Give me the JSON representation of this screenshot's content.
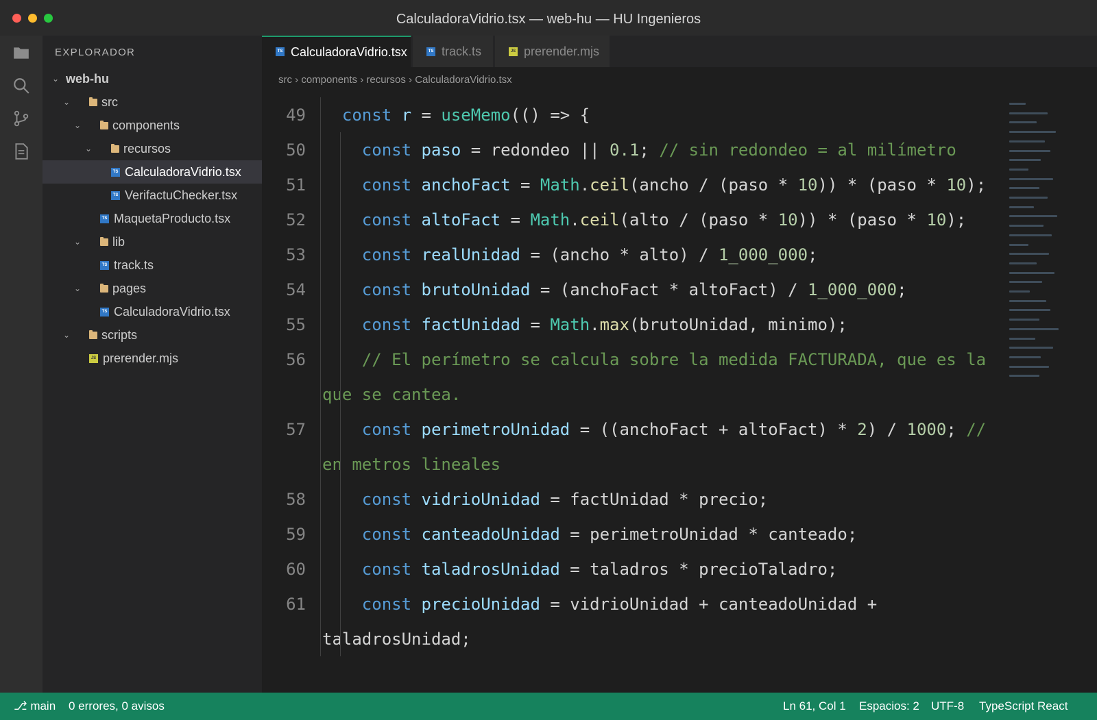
{
  "window": {
    "title": "CalculadoraVidrio.tsx — web-hu — HU Ingenieros"
  },
  "activity_bar": {
    "icons": [
      "files-icon",
      "search-icon",
      "source-control-icon",
      "document-icon"
    ]
  },
  "sidebar": {
    "title": "EXPLORADOR",
    "tree": [
      {
        "label": "web-hu",
        "kind": "root",
        "depth": 0,
        "expanded": true
      },
      {
        "label": "src",
        "kind": "folder",
        "depth": 1,
        "expanded": true
      },
      {
        "label": "components",
        "kind": "folder",
        "depth": 2,
        "expanded": true
      },
      {
        "label": "recursos",
        "kind": "folder",
        "depth": 3,
        "expanded": true
      },
      {
        "label": "CalculadoraVidrio.tsx",
        "kind": "ts",
        "depth": 4,
        "selected": true
      },
      {
        "label": "VerifactuChecker.tsx",
        "kind": "ts",
        "depth": 4
      },
      {
        "label": "MaquetaProducto.tsx",
        "kind": "ts",
        "depth": 3
      },
      {
        "label": "lib",
        "kind": "folder",
        "depth": 2,
        "expanded": true
      },
      {
        "label": "track.ts",
        "kind": "ts",
        "depth": 3
      },
      {
        "label": "pages",
        "kind": "folder",
        "depth": 2,
        "expanded": true
      },
      {
        "label": "CalculadoraVidrio.tsx",
        "kind": "ts",
        "depth": 3
      },
      {
        "label": "scripts",
        "kind": "folder",
        "depth": 1,
        "expanded": true
      },
      {
        "label": "prerender.mjs",
        "kind": "js",
        "depth": 2
      }
    ]
  },
  "tabs": [
    {
      "label": "CalculadoraVidrio.tsx",
      "kind": "ts",
      "active": true
    },
    {
      "label": "track.ts",
      "kind": "ts",
      "active": false
    },
    {
      "label": "prerender.mjs",
      "kind": "js",
      "active": false
    }
  ],
  "breadcrumb": "src › components › recursos › CalculadoraVidrio.tsx",
  "code": {
    "lines": [
      {
        "n": "49",
        "indent": 1,
        "tokens": [
          [
            "kw",
            "const"
          ],
          [
            "t",
            " "
          ],
          [
            "var",
            "r"
          ],
          [
            "t",
            " = "
          ],
          [
            "cls",
            "useMemo"
          ],
          [
            "t",
            "(() => {"
          ]
        ]
      },
      {
        "n": "50",
        "indent": 2,
        "tokens": [
          [
            "kw",
            "const"
          ],
          [
            "t",
            " "
          ],
          [
            "var",
            "paso"
          ],
          [
            "t",
            " = redondeo || "
          ],
          [
            "num",
            "0.1"
          ],
          [
            "t",
            "; "
          ],
          [
            "cm",
            "// sin redondeo = al milímetro"
          ]
        ]
      },
      {
        "n": "51",
        "indent": 2,
        "tokens": [
          [
            "kw",
            "const"
          ],
          [
            "t",
            " "
          ],
          [
            "var",
            "anchoFact"
          ],
          [
            "t",
            " = "
          ],
          [
            "cls",
            "Math"
          ],
          [
            "t",
            "."
          ],
          [
            "fn",
            "ceil"
          ],
          [
            "t",
            "(ancho / (paso * "
          ],
          [
            "num",
            "10"
          ],
          [
            "t",
            ")) * (paso * "
          ],
          [
            "num",
            "10"
          ],
          [
            "t",
            ");"
          ]
        ]
      },
      {
        "n": "52",
        "indent": 2,
        "tokens": [
          [
            "kw",
            "const"
          ],
          [
            "t",
            " "
          ],
          [
            "var",
            "altoFact"
          ],
          [
            "t",
            " = "
          ],
          [
            "cls",
            "Math"
          ],
          [
            "t",
            "."
          ],
          [
            "fn",
            "ceil"
          ],
          [
            "t",
            "(alto / (paso * "
          ],
          [
            "num",
            "10"
          ],
          [
            "t",
            ")) * (paso * "
          ],
          [
            "num",
            "10"
          ],
          [
            "t",
            ");"
          ]
        ]
      },
      {
        "n": "53",
        "indent": 2,
        "tokens": [
          [
            "kw",
            "const"
          ],
          [
            "t",
            " "
          ],
          [
            "var",
            "realUnidad"
          ],
          [
            "t",
            " = (ancho * alto) / "
          ],
          [
            "num",
            "1_000_000"
          ],
          [
            "t",
            ";"
          ]
        ]
      },
      {
        "n": "54",
        "indent": 2,
        "tokens": [
          [
            "kw",
            "const"
          ],
          [
            "t",
            " "
          ],
          [
            "var",
            "brutoUnidad"
          ],
          [
            "t",
            " = (anchoFact * altoFact) / "
          ],
          [
            "num",
            "1_000_000"
          ],
          [
            "t",
            ";"
          ]
        ]
      },
      {
        "n": "55",
        "indent": 2,
        "tokens": [
          [
            "kw",
            "const"
          ],
          [
            "t",
            " "
          ],
          [
            "var",
            "factUnidad"
          ],
          [
            "t",
            " = "
          ],
          [
            "cls",
            "Math"
          ],
          [
            "t",
            "."
          ],
          [
            "fn",
            "max"
          ],
          [
            "t",
            "(brutoUnidad, minimo);"
          ]
        ]
      },
      {
        "n": "56",
        "indent": 2,
        "tokens": [
          [
            "cm",
            "// El perímetro se calcula sobre la medida FACTURADA, que es la"
          ]
        ]
      },
      {
        "n": "",
        "indent": 0,
        "tokens": [
          [
            "cm",
            "que se cantea."
          ]
        ]
      },
      {
        "n": "57",
        "indent": 2,
        "tokens": [
          [
            "kw",
            "const"
          ],
          [
            "t",
            " "
          ],
          [
            "var",
            "perimetroUnidad"
          ],
          [
            "t",
            " = ((anchoFact + altoFact) * "
          ],
          [
            "num",
            "2"
          ],
          [
            "t",
            ") / "
          ],
          [
            "num",
            "1000"
          ],
          [
            "t",
            "; "
          ],
          [
            "cm",
            "//"
          ]
        ]
      },
      {
        "n": "",
        "indent": 0,
        "tokens": [
          [
            "cm",
            "en metros lineales"
          ]
        ]
      },
      {
        "n": "58",
        "indent": 2,
        "tokens": [
          [
            "kw",
            "const"
          ],
          [
            "t",
            " "
          ],
          [
            "var",
            "vidrioUnidad"
          ],
          [
            "t",
            " = factUnidad * precio;"
          ]
        ]
      },
      {
        "n": "59",
        "indent": 2,
        "tokens": [
          [
            "kw",
            "const"
          ],
          [
            "t",
            " "
          ],
          [
            "var",
            "canteadoUnidad"
          ],
          [
            "t",
            " = perimetroUnidad * canteado;"
          ]
        ]
      },
      {
        "n": "60",
        "indent": 2,
        "tokens": [
          [
            "kw",
            "const"
          ],
          [
            "t",
            " "
          ],
          [
            "var",
            "taladrosUnidad"
          ],
          [
            "t",
            " = taladros * precioTaladro;"
          ]
        ]
      },
      {
        "n": "61",
        "indent": 2,
        "tokens": [
          [
            "kw",
            "const"
          ],
          [
            "t",
            " "
          ],
          [
            "var",
            "precioUnidad"
          ],
          [
            "t",
            " = vidrioUnidad + canteadoUnidad +"
          ]
        ]
      },
      {
        "n": "",
        "indent": 0,
        "tokens": [
          [
            "t",
            "taladrosUnidad;"
          ]
        ]
      }
    ]
  },
  "status_bar": {
    "branch": "⎇ main",
    "problems": "0 errores, 0 avisos",
    "position": "Ln 61, Col 1",
    "spaces": "Espacios: 2",
    "encoding": "UTF-8",
    "language": "TypeScript React"
  },
  "colors": {
    "status_bar": "#16825d",
    "keyword": "#569cd6",
    "variable": "#9cdcfe",
    "function": "#dcdcaa",
    "class": "#4ec9b0",
    "number": "#b5cea8",
    "comment": "#6a9955"
  }
}
